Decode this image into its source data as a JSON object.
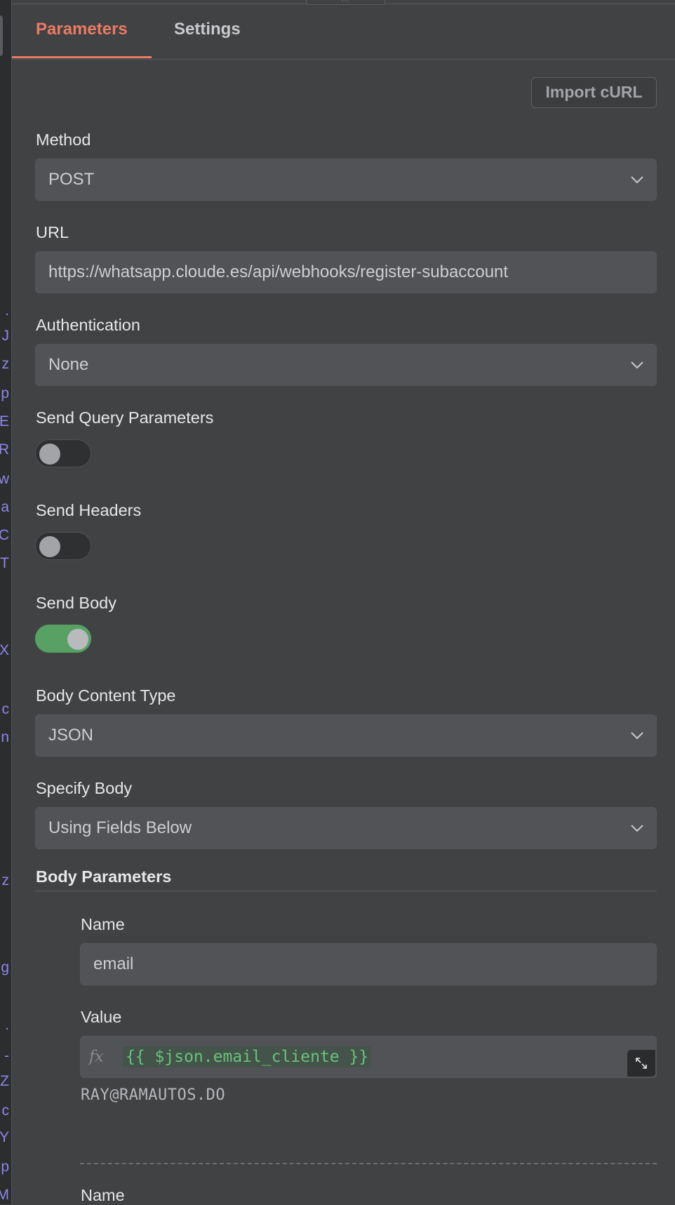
{
  "tabs": [
    {
      "label": "Parameters",
      "active": true
    },
    {
      "label": "Settings",
      "active": false
    }
  ],
  "import_curl_label": "Import cURL",
  "fields": {
    "method": {
      "label": "Method",
      "value": "POST"
    },
    "url": {
      "label": "URL",
      "value": "https://whatsapp.cloude.es/api/webhooks/register-subaccount"
    },
    "authentication": {
      "label": "Authentication",
      "value": "None"
    },
    "send_query": {
      "label": "Send Query Parameters",
      "on": false
    },
    "send_headers": {
      "label": "Send Headers",
      "on": false
    },
    "send_body": {
      "label": "Send Body",
      "on": true
    },
    "body_content_type": {
      "label": "Body Content Type",
      "value": "JSON"
    },
    "specify_body": {
      "label": "Specify Body",
      "value": "Using Fields Below"
    }
  },
  "body_parameters": {
    "title": "Body Parameters",
    "items": [
      {
        "name_label": "Name",
        "name_value": "email",
        "value_label": "Value",
        "fx": "fx",
        "expression": "{{ $json.email_cliente }}",
        "preview": "RAY@RAMAUTOS.DO"
      },
      {
        "name_label": "Name"
      }
    ]
  },
  "left_strip_glyphs": [
    ".",
    "J",
    "z",
    "p",
    "E",
    "R",
    "w",
    "a",
    "C",
    "T",
    "X",
    "c",
    "n",
    "z",
    "g",
    ".",
    "-",
    "Z",
    "c",
    "Y",
    "p",
    "M"
  ],
  "colors": {
    "accent": "#ea7a64",
    "toggle_on": "#58a165",
    "expression": "#69c27c",
    "background": "#414244"
  }
}
